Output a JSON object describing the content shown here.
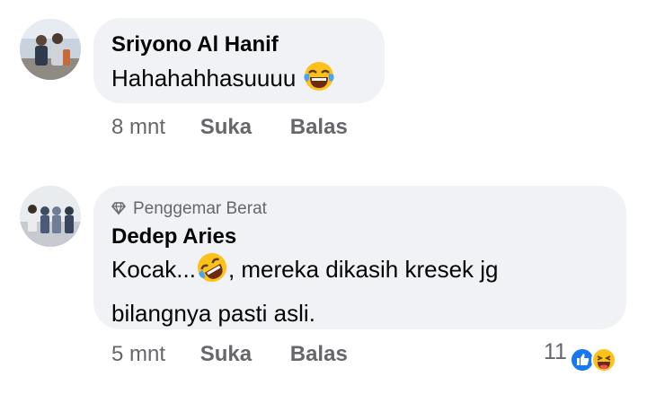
{
  "comments": [
    {
      "author": "Sriyono Al Hanif",
      "text": "Hahahahhasuuuu",
      "trailing_emoji": "laughing-tears-emoji",
      "time": "8 mnt",
      "like_label": "Suka",
      "reply_label": "Balas"
    },
    {
      "badge": "Penggemar Berat",
      "author": "Dedep Aries",
      "text_before_emoji": "Kocak...",
      "inline_emoji": "rolling-laughing-emoji",
      "text_after_emoji": ", mereka dikasih kresek jg",
      "text_line2": "bilangnya pasti asli.",
      "time": "5 mnt",
      "like_label": "Suka",
      "reply_label": "Balas",
      "reaction_count": "11",
      "reaction_icons": [
        "like-reaction-icon",
        "haha-reaction-icon"
      ]
    }
  ],
  "colors": {
    "bubble": "#f0f2f5",
    "text": "#050505",
    "secondary": "#65676b",
    "like_blue": "#1877f2",
    "emoji_yellow": "#fcc21b"
  }
}
